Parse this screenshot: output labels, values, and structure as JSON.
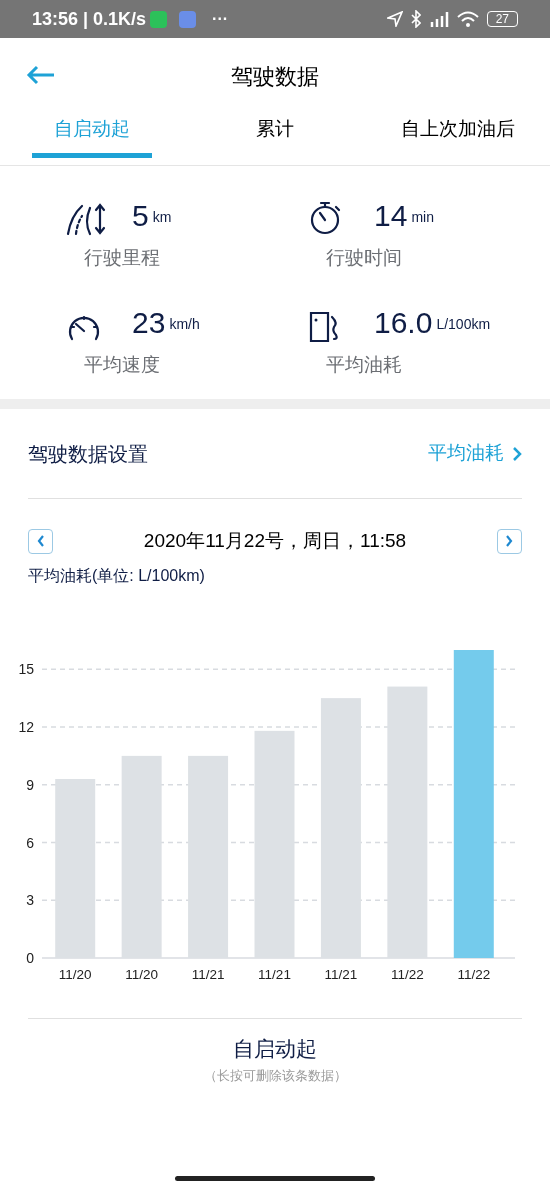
{
  "status_bar": {
    "time": "13:56 | 0.1K/s",
    "more": "···",
    "battery": "27"
  },
  "header": {
    "title": "驾驶数据"
  },
  "tabs": [
    {
      "label": "自启动起",
      "selected": true
    },
    {
      "label": "累计",
      "selected": false
    },
    {
      "label": "自上次加油后",
      "selected": false
    }
  ],
  "stats": [
    {
      "kind": "distance",
      "value": "5",
      "unit": "km",
      "label": "行驶里程"
    },
    {
      "kind": "time",
      "value": "14",
      "unit": "min",
      "label": "行驶时间"
    },
    {
      "kind": "speed",
      "value": "23",
      "unit": "km/h",
      "label": "平均速度"
    },
    {
      "kind": "fuel",
      "value": "16.0",
      "unit": "L/100km",
      "label": "平均油耗"
    }
  ],
  "settings": {
    "title": "驾驶数据设置",
    "link": "平均油耗"
  },
  "date_nav": {
    "date": "2020年11月22号，周日，11:58"
  },
  "chart_label": "平均油耗(单位: L/100km)",
  "chart_data": {
    "type": "bar",
    "categories": [
      "11/20",
      "11/20",
      "11/21",
      "11/21",
      "11/21",
      "11/22",
      "11/22"
    ],
    "series": [
      {
        "color": "#dde1e5",
        "values": [
          9.3,
          10.5,
          10.5,
          11.8,
          13.5,
          14.1,
          null
        ]
      },
      {
        "color": "#74cbec",
        "values": [
          null,
          null,
          null,
          null,
          null,
          null,
          16.0
        ]
      }
    ],
    "ylim": [
      0,
      16
    ],
    "yticks": [
      0,
      3,
      6,
      9,
      12,
      15
    ],
    "grid": true
  },
  "footer": {
    "title": "自启动起",
    "note": "（长按可删除该条数据）"
  }
}
